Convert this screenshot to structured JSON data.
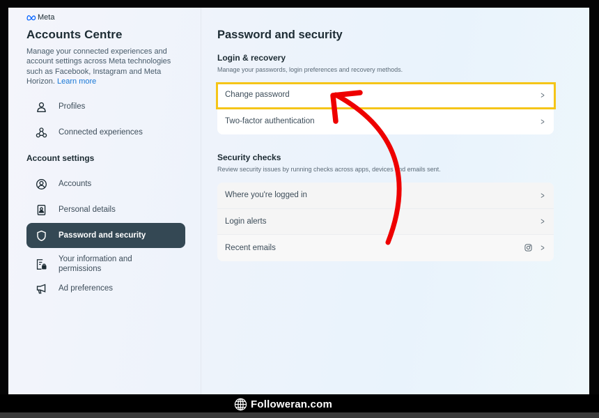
{
  "sidebar": {
    "brand": "Meta",
    "title": "Accounts Centre",
    "description": "Manage your connected experiences and account settings across Meta technologies such as Facebook, Instagram and Meta Horizon.",
    "learn_more": "Learn more",
    "top_items": [
      {
        "label": "Profiles",
        "icon": "person-icon"
      },
      {
        "label": "Connected experiences",
        "icon": "connected-icon"
      }
    ],
    "section_label": "Account settings",
    "items": [
      {
        "label": "Accounts",
        "icon": "account-circle-icon"
      },
      {
        "label": "Personal details",
        "icon": "id-card-icon"
      },
      {
        "label": "Password and security",
        "icon": "shield-icon",
        "active": true
      },
      {
        "label": "Your information and permissions",
        "icon": "info-lock-icon"
      },
      {
        "label": "Ad preferences",
        "icon": "megaphone-icon"
      }
    ]
  },
  "main": {
    "title": "Password and security",
    "login_recovery": {
      "title": "Login & recovery",
      "description": "Manage your passwords, login preferences and recovery methods.",
      "rows": [
        {
          "label": "Change password",
          "highlighted": true
        },
        {
          "label": "Two-factor authentication"
        }
      ]
    },
    "security_checks": {
      "title": "Security checks",
      "description": "Review security issues by running checks across apps, devices and emails sent.",
      "rows": [
        {
          "label": "Where you're logged in"
        },
        {
          "label": "Login alerts"
        },
        {
          "label": "Recent emails",
          "badge_icon": "instagram-icon"
        }
      ]
    }
  },
  "annotations": {
    "highlight_color": "#f5c518",
    "arrow_color": "#ee0000"
  },
  "watermark": {
    "text": "Followeran.com",
    "icon": "globe-icon"
  }
}
